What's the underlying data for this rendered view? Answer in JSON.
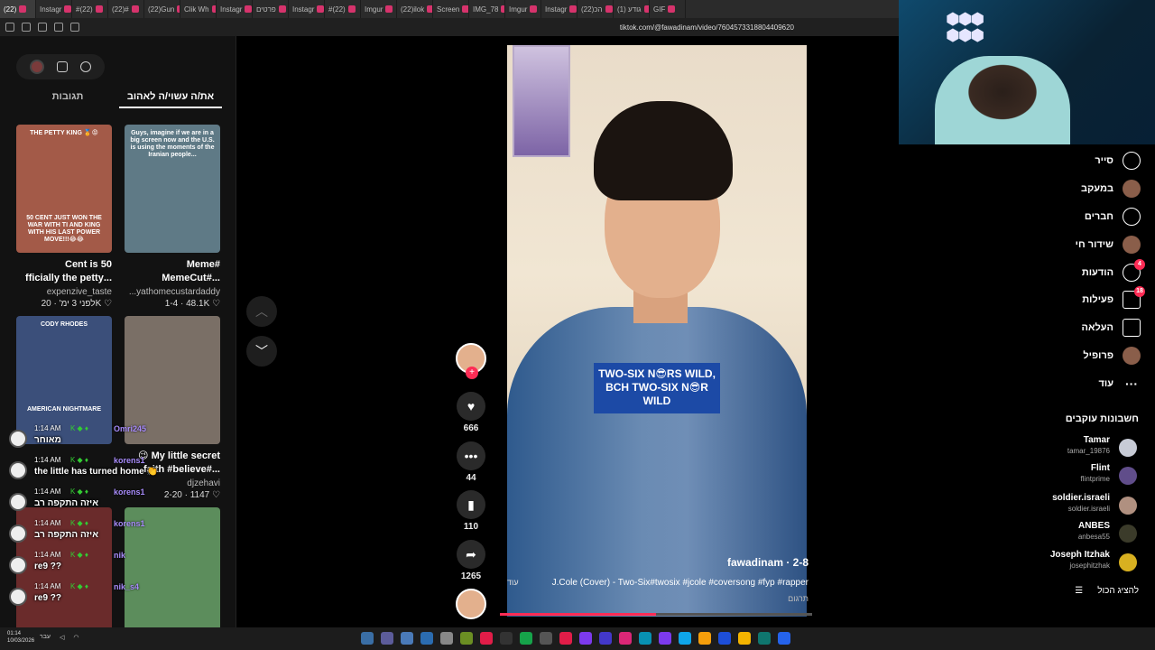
{
  "browser": {
    "tabs": [
      "(22)",
      "Instagr",
      "#(22)",
      "(22)#",
      "(22)Gun",
      "Clik Wh",
      "Instagr",
      "פרטים",
      "Instagr",
      "#(22)",
      "Imgur",
      "(22)ilok",
      "Screen",
      "IMG_78",
      "Imgur",
      "Instagr",
      "(22)הכ",
      "(1) גודע",
      "GIF"
    ],
    "active_tab_index": 0,
    "url": "tiktok.com/@fawadinam/video/7604573318804409620"
  },
  "left_panel": {
    "tabs": [
      "את/ה עשוי/ה לאהוב",
      "תגובות"
    ],
    "active_tab": 0,
    "cards": [
      {
        "caption": "THE PETTY KING 🏅😡",
        "subcaption": "50 CENT JUST WON THE WAR WITH TI AND KING WITH HIS LAST POWER MOVE!!!😂😂",
        "title": "50 Cent is\n...fficially the petty",
        "user": "expenzive_taste",
        "views": "20K",
        "date": "לפני 3 ימ'",
        "thumb_color": "#a35a48"
      },
      {
        "caption": "Guys, imagine if we are in a big screen now and the U.S. is using the moments of the Iranian people...",
        "subcaption": "",
        "title": "#Meme\n...#MemeCut",
        "user": "...yathomecustardaddy",
        "views": "48.1K",
        "date": "1-4",
        "thumb_color": "#5f7a86"
      },
      {
        "caption": "CODY RHODES",
        "subcaption": "AMERICAN NIGHTMARE",
        "title": "",
        "user": "",
        "views": "",
        "date": "",
        "thumb_color": "#3b4f7a"
      },
      {
        "caption": "",
        "subcaption": "",
        "title": "My little secret 😉\n...#faith #believe",
        "user": "djzehavi",
        "views": "1147",
        "date": "2-20",
        "thumb_color": "#7a6f66"
      },
      {
        "caption": "",
        "subcaption": "",
        "title": "",
        "user": "",
        "views": "",
        "date": "",
        "thumb_color": "#6a2b2b"
      },
      {
        "caption": "",
        "subcaption": "",
        "title": "",
        "user": "",
        "views": "",
        "date": "",
        "thumb_color": "#5c8d5c"
      }
    ]
  },
  "chat": [
    {
      "time": "1:14 AM",
      "nick": "Omri245",
      "msg": "מאוחר"
    },
    {
      "time": "1:14 AM",
      "nick": "korens1",
      "msg": "the little has turned home 👏"
    },
    {
      "time": "1:14 AM",
      "nick": "korens1",
      "msg": "איזה התקפה רב"
    },
    {
      "time": "1:14 AM",
      "nick": "korens1",
      "msg": "איזה התקפה רב"
    },
    {
      "time": "1:14 AM",
      "nick": "nik",
      "msg": "re9 ??"
    },
    {
      "time": "1:14 AM",
      "nik2": "",
      "nick": "nik_s4",
      "msg": "re9 ??"
    }
  ],
  "video": {
    "overlay_text": "TWO-SIX N😎RS WILD, BCH TWO-SIX N😎R WILD",
    "username": "fawadinam",
    "date": "2-8",
    "description": "J.Cole (Cover) - Two-Six#twosix #jcole #coversong #fyp #rapper",
    "more": "עוד",
    "translate": "תרגום",
    "progress_percent": 50
  },
  "actions": {
    "likes": "666",
    "comments": "44",
    "saves": "110",
    "shares": "1265",
    "follow_plus": "+"
  },
  "right_nav": {
    "items": [
      {
        "label": "סייר",
        "icon": "compass-icon"
      },
      {
        "label": "במעקב",
        "icon": "following-avatar-icon"
      },
      {
        "label": "חברים",
        "icon": "friends-icon"
      },
      {
        "label": "שידור חי",
        "icon": "live-icon"
      },
      {
        "label": "הודעות",
        "icon": "messages-icon",
        "badge": "4"
      },
      {
        "label": "פעילות",
        "icon": "activity-icon",
        "badge": "18"
      },
      {
        "label": "העלאה",
        "icon": "upload-icon"
      },
      {
        "label": "פרופיל",
        "icon": "profile-icon"
      },
      {
        "label": "עוד",
        "icon": "more-icon"
      }
    ],
    "following_heading": "חשבונות עוקבים",
    "accounts": [
      {
        "name": "Tamar",
        "handle": "tamar_19876"
      },
      {
        "name": "Flint",
        "handle": "flintprime"
      },
      {
        "name": "soldier.israeli",
        "handle": "soldier.israeli"
      },
      {
        "name": "ANBES",
        "handle": "anbesa55"
      },
      {
        "name": "Joseph Itzhak",
        "handle": "josephitzhak"
      }
    ],
    "show_all": "להציג הכול"
  },
  "taskbar": {
    "time": "01:14",
    "date": "10/03/2026",
    "lang": "עבר"
  }
}
